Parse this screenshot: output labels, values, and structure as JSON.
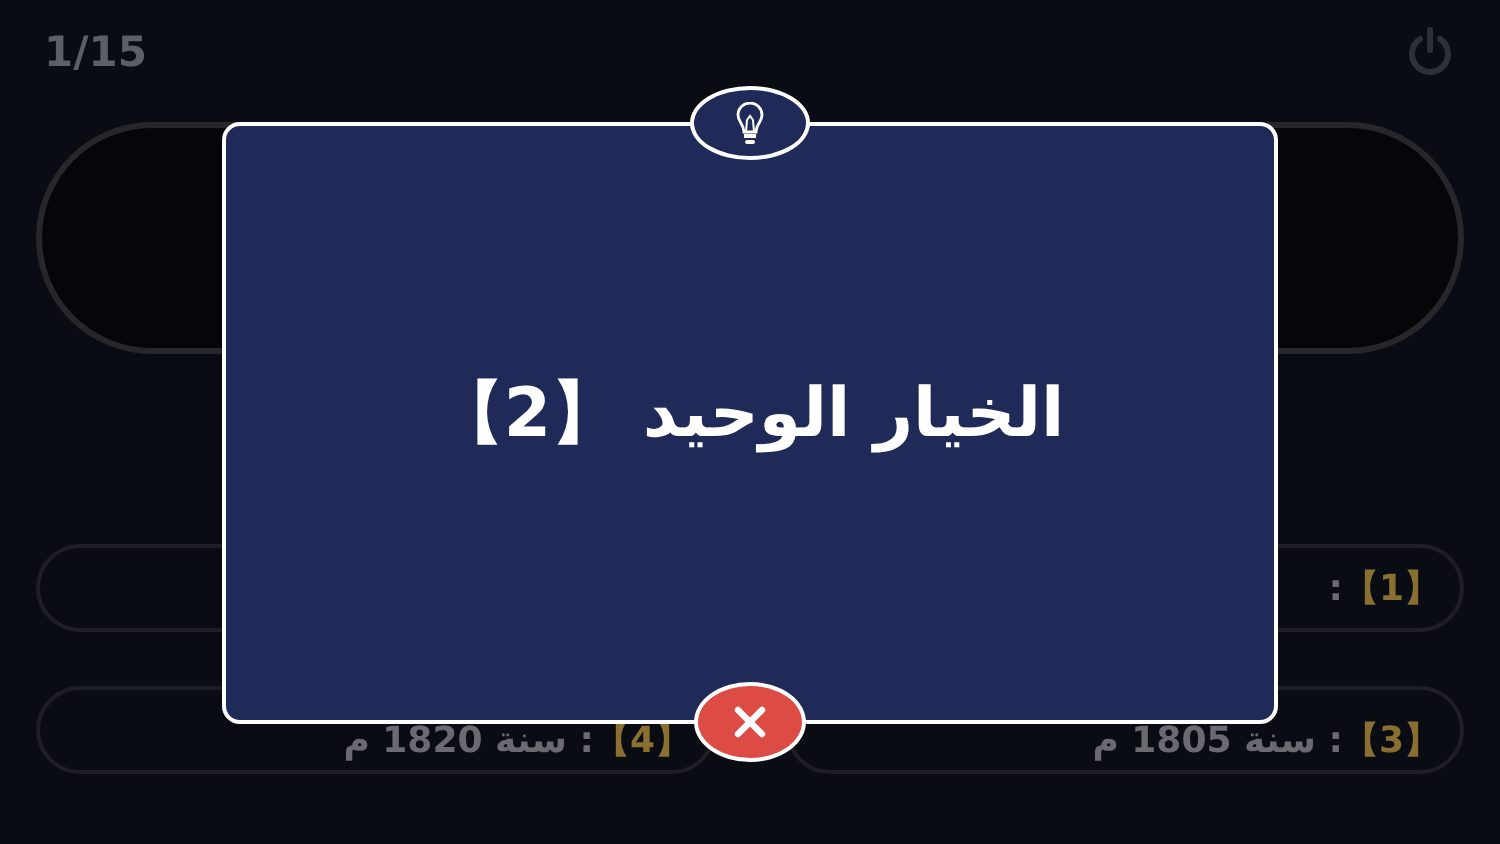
{
  "header": {
    "counter": "1/15"
  },
  "answers": [
    {
      "label": "【1】",
      "text": ":"
    },
    {
      "covered": true
    },
    {
      "label": "【3】",
      "text": ": سنة 1805 م"
    },
    {
      "label": "【4】",
      "text": ": سنة 1820 م"
    }
  ],
  "dialog": {
    "message": "الخيار الوحيد 【2】"
  }
}
